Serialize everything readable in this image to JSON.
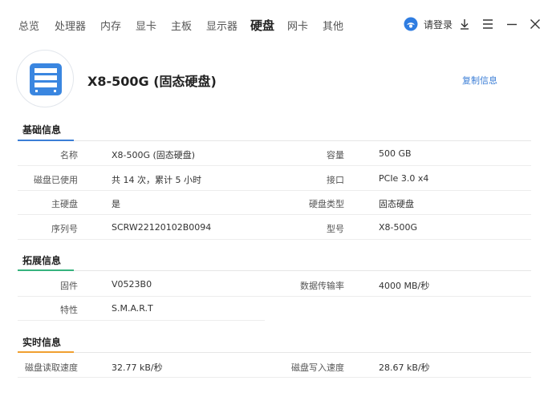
{
  "nav": {
    "tabs": [
      "总览",
      "处理器",
      "内存",
      "显卡",
      "主板",
      "显示器",
      "硬盘",
      "网卡",
      "其他"
    ],
    "active_tab": "硬盘"
  },
  "toolbar": {
    "login_label": "请登录",
    "icons": [
      "login-avatar-icon",
      "download-icon",
      "menu-icon",
      "minimize-icon",
      "close-icon"
    ]
  },
  "device": {
    "title": "X8-500G (固态硬盘)",
    "copy_label": "复制信息",
    "icon": "ssd-icon"
  },
  "sections": {
    "basic": {
      "title": "基础信息",
      "rows": [
        {
          "label_l": "名称",
          "value_l": "X8-500G (固态硬盘)",
          "label_r": "容量",
          "value_r": "500 GB"
        },
        {
          "label_l": "磁盘已使用",
          "value_l": "共 14 次，累计 5 小时",
          "label_r": "接口",
          "value_r": "PCIe 3.0 x4"
        },
        {
          "label_l": "主硬盘",
          "value_l": "是",
          "label_r": "硬盘类型",
          "value_r": "固态硬盘"
        },
        {
          "label_l": "序列号",
          "value_l": "SCRW22120102B0094",
          "label_r": "型号",
          "value_r": "X8-500G"
        }
      ]
    },
    "extended": {
      "title": "拓展信息",
      "rows": [
        {
          "label_l": "固件",
          "value_l": "V0523B0",
          "label_r": "数据传输率",
          "value_r": "4000 MB/秒"
        },
        {
          "label_l": "特性",
          "value_l": "S.M.A.R.T"
        }
      ]
    },
    "realtime": {
      "title": "实时信息",
      "rows": [
        {
          "label_l": "磁盘读取速度",
          "value_l": "32.77 kB/秒",
          "label_r": "磁盘写入速度",
          "value_r": "28.67 kB/秒"
        }
      ]
    }
  },
  "colors": {
    "accent_blue": "#3b7ed6",
    "basic_underline": "#3b7ed6",
    "extended_underline": "#36b37e",
    "realtime_underline": "#f0a030"
  }
}
